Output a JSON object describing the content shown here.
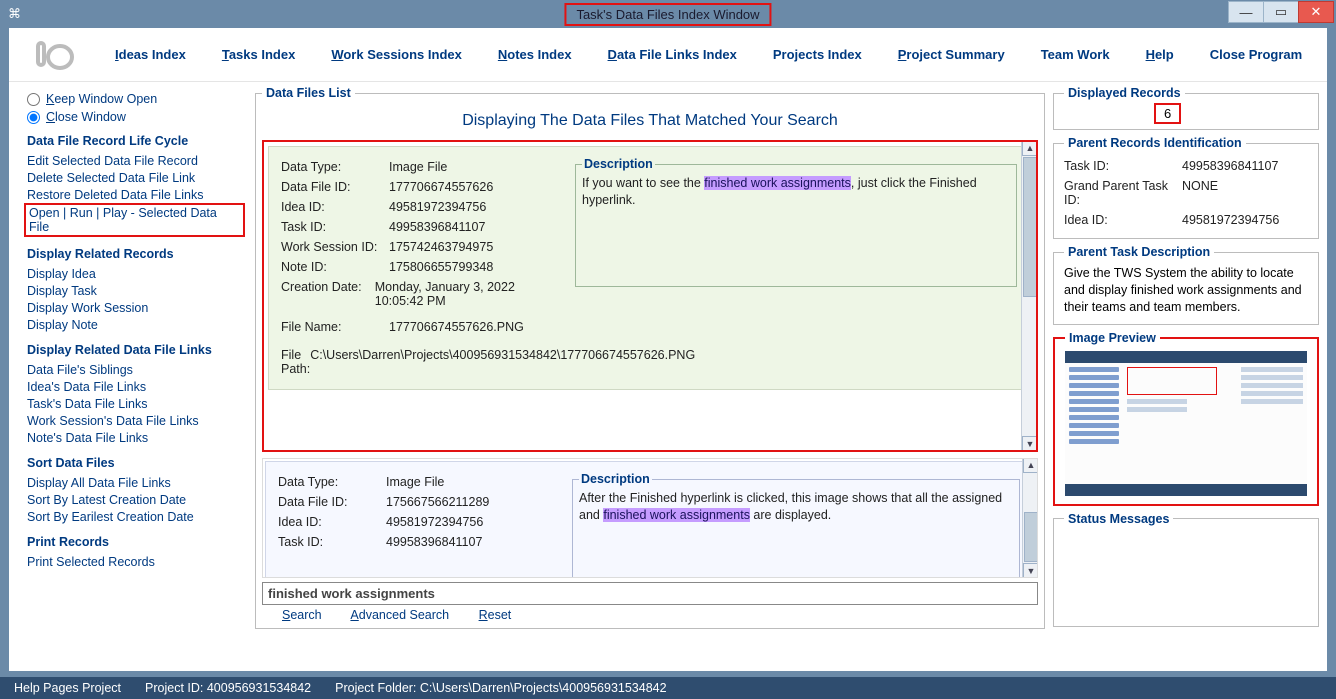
{
  "window": {
    "title": "Task's Data Files Index Window"
  },
  "nav": {
    "ideas": "Ideas Index",
    "tasks": "Tasks Index",
    "work_sessions": "Work Sessions Index",
    "notes": "Notes Index",
    "dfl": "Data File Links Index",
    "projects": "Projects Index",
    "proj_summary": "Project Summary",
    "teamwork": "Team Work",
    "help": "Help",
    "close": "Close Program"
  },
  "sidebar": {
    "keep_open": "Keep Window Open",
    "close_window": "Close Window",
    "heading_lifecycle": "Data File Record Life Cycle",
    "edit_sel": "Edit Selected Data File Record",
    "del_sel": "Delete Selected Data File Link",
    "restore": "Restore Deleted Data File Links",
    "open_run_play": "Open | Run | Play - Selected Data File",
    "heading_related": "Display Related Records",
    "disp_idea": "Display Idea",
    "disp_task": "Display Task",
    "disp_ws": "Display Work Session",
    "disp_note": "Display Note",
    "heading_related_dfl": "Display Related Data File Links",
    "siblings": "Data File's Siblings",
    "idea_dfl": "Idea's Data File Links",
    "task_dfl": "Task's Data File Links",
    "ws_dfl": "Work Session's Data File Links",
    "note_dfl": "Note's Data File Links",
    "heading_sort": "Sort Data Files",
    "display_all": "Display All Data File Links",
    "sort_latest": "Sort By Latest Creation Date",
    "sort_earliest": "Sort By Earilest Creation Date",
    "heading_print": "Print Records",
    "print_sel": "Print Selected Records"
  },
  "main": {
    "box_title": "Data Files List",
    "heading": "Displaying The Data Files That Matched Your Search",
    "labels": {
      "data_type": "Data Type:",
      "dfid": "Data File ID:",
      "idea_id": "Idea ID:",
      "task_id": "Task ID:",
      "ws_id": "Work Session ID:",
      "note_id": "Note ID:",
      "creation": "Creation Date:",
      "file_name": "File Name:",
      "file_path": "File Path:",
      "description": "Description"
    },
    "record1": {
      "data_type": "Image File",
      "dfid": "177706674557626",
      "idea_id": "49581972394756",
      "task_id": "49958396841107",
      "ws_id": "175742463794975",
      "note_id": "175806655799348",
      "creation": "Monday, January 3, 2022   10:05:42 PM",
      "file_name": "177706674557626.PNG",
      "file_path": "C:\\Users\\Darren\\Projects\\400956931534842\\177706674557626.PNG",
      "desc_before": "If you want to see the ",
      "desc_highlight": "finished work assignments",
      "desc_after": ", just click the Finished hyperlink."
    },
    "record2": {
      "data_type": "Image File",
      "dfid": "175667566211289",
      "idea_id": "49581972394756",
      "task_id": "49958396841107",
      "desc_before": "After the Finished hyperlink is clicked, this image shows that all the assigned and ",
      "desc_highlight": "finished work assignments",
      "desc_after": " are displayed."
    },
    "search_value": "finished work assignments",
    "search_label": "Search",
    "adv_search_label": "Advanced Search",
    "reset_label": "Reset"
  },
  "right": {
    "displayed_records_title": "Displayed Records",
    "displayed_records_value": "6",
    "parent_ids_title": "Parent Records Identification",
    "parent": {
      "task_id_label": "Task ID:",
      "task_id": "49958396841107",
      "grand_label": "Grand Parent Task ID:",
      "grand": "NONE",
      "idea_label": "Idea ID:",
      "idea": "49581972394756"
    },
    "parent_desc_title": "Parent Task Description",
    "parent_desc": "Give the TWS System the ability to locate and display finished work assignments and their teams and team members.",
    "preview_title": "Image Preview",
    "status_title": "Status Messages"
  },
  "status": {
    "help": "Help Pages Project",
    "pid_label": "Project ID: ",
    "pid": "400956931534842",
    "pfolder_label": "Project Folder: ",
    "pfolder": "C:\\Users\\Darren\\Projects\\400956931534842"
  }
}
